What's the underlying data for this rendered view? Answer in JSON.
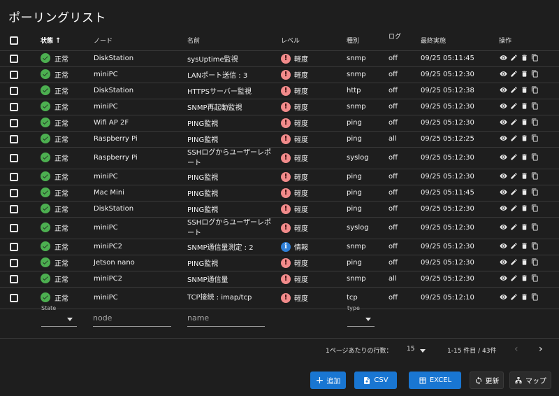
{
  "title": "ポーリングリスト",
  "columns": {
    "status": "状態",
    "node": "ノード",
    "name": "名前",
    "level": "レベル",
    "type": "種別",
    "log": "ログ",
    "last": "最終実施",
    "ops": "操作"
  },
  "rows": [
    {
      "status": "正常",
      "node": "DiskStation",
      "name": "sysUptime監視",
      "level": "軽度",
      "type": "snmp",
      "log": "off",
      "last": "09/25 05:11:45"
    },
    {
      "status": "正常",
      "node": "miniPC",
      "name": "LANポート送信 : 3",
      "level": "軽度",
      "type": "snmp",
      "log": "off",
      "last": "09/25 05:12:30"
    },
    {
      "status": "正常",
      "node": "DiskStation",
      "name": "HTTPSサーバー監視",
      "level": "軽度",
      "type": "http",
      "log": "off",
      "last": "09/25 05:12:38"
    },
    {
      "status": "正常",
      "node": "miniPC",
      "name": "SNMP再起動監視",
      "level": "軽度",
      "type": "snmp",
      "log": "off",
      "last": "09/25 05:12:30"
    },
    {
      "status": "正常",
      "node": "Wifi AP 2F",
      "name": "PING監視",
      "level": "軽度",
      "type": "ping",
      "log": "off",
      "last": "09/25 05:12:30"
    },
    {
      "status": "正常",
      "node": "Raspberry Pi",
      "name": "PING監視",
      "level": "軽度",
      "type": "ping",
      "log": "all",
      "last": "09/25 05:12:25"
    },
    {
      "status": "正常",
      "node": "Raspberry Pi",
      "name": "SSHログからユーザーレポート",
      "level": "軽度",
      "type": "syslog",
      "log": "off",
      "last": "09/25 05:12:30"
    },
    {
      "status": "正常",
      "node": "miniPC",
      "name": "PING監視",
      "level": "軽度",
      "type": "ping",
      "log": "off",
      "last": "09/25 05:12:30"
    },
    {
      "status": "正常",
      "node": "Mac Mini",
      "name": "PING監視",
      "level": "軽度",
      "type": "ping",
      "log": "off",
      "last": "09/25 05:11:45"
    },
    {
      "status": "正常",
      "node": "DiskStation",
      "name": "PING監視",
      "level": "軽度",
      "type": "ping",
      "log": "off",
      "last": "09/25 05:12:30"
    },
    {
      "status": "正常",
      "node": "miniPC",
      "name": "SSHログからユーザーレポート",
      "level": "軽度",
      "type": "syslog",
      "log": "off",
      "last": "09/25 05:12:30"
    },
    {
      "status": "正常",
      "node": "miniPC2",
      "name": "SNMP通信量測定 : 2",
      "level": "情報",
      "type": "snmp",
      "log": "off",
      "last": "09/25 05:12:30"
    },
    {
      "status": "正常",
      "node": "Jetson nano",
      "name": "PING監視",
      "level": "軽度",
      "type": "ping",
      "log": "off",
      "last": "09/25 05:12:30"
    },
    {
      "status": "正常",
      "node": "miniPC2",
      "name": "SNMP通信量",
      "level": "軽度",
      "type": "snmp",
      "log": "all",
      "last": "09/25 05:12:30"
    },
    {
      "status": "正常",
      "node": "miniPC",
      "name": "TCP接続 : imap/tcp",
      "level": "軽度",
      "type": "tcp",
      "log": "off",
      "last": "09/25 05:12:10"
    }
  ],
  "filters": {
    "state_label": "State",
    "node_placeholder": "node",
    "name_placeholder": "name",
    "type_label": "type"
  },
  "pager": {
    "rows_label": "1ページあたりの行数：",
    "rows_value": "15",
    "range": "1-15 件目 / 43件"
  },
  "buttons": {
    "add": "追加",
    "csv": "CSV",
    "excel": "EXCEL",
    "refresh": "更新",
    "map": "マップ"
  },
  "colors": {
    "background": "#1e1e1e",
    "primary": "#1976d2",
    "ok": "#4caf50",
    "warn": "#f28b8b",
    "info": "#2f7fd6"
  }
}
